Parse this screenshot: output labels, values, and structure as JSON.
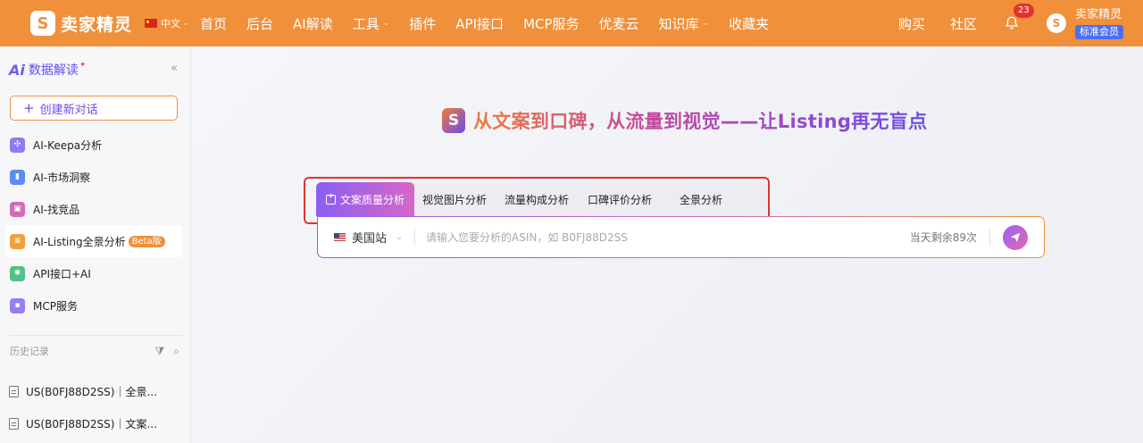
{
  "header": {
    "brand": "卖家精灵",
    "lang": "中文",
    "nav": [
      "首页",
      "后台",
      "AI解读",
      "工具",
      "插件",
      "API接口",
      "MCP服务",
      "优麦云",
      "知识库",
      "收藏夹"
    ],
    "buy": "购买",
    "community": "社区",
    "notification_count": "23",
    "user_name": "卖家精灵",
    "membership": "标准会员",
    "avatar_text": "S"
  },
  "sidebar": {
    "logo": "Ai",
    "title": "数据解读",
    "new_chat": "创建新对话",
    "items": [
      {
        "label": "AI-Keepa分析",
        "color": "#8f7bf2"
      },
      {
        "label": "AI-市场洞察",
        "color": "#5d8cf5"
      },
      {
        "label": "AI-找竞品",
        "color": "#d46bb7"
      },
      {
        "label": "AI-Listing全景分析",
        "color": "#f0a13b",
        "badge": "Beta版"
      },
      {
        "label": "API接口+AI",
        "color": "#52c187"
      },
      {
        "label": "MCP服务",
        "color": "#9a7df3"
      }
    ],
    "history_title": "历史记录",
    "history": [
      "US(B0FJ88D2SS)｜全景...",
      "US(B0FJ88D2SS)｜文案..."
    ]
  },
  "main": {
    "headline": "从文案到口碑，从流量到视觉——让Listing再无盲点",
    "tabs": [
      "文案质量分析",
      "视觉图片分析",
      "流量构成分析",
      "口碑评价分析",
      "全景分析"
    ],
    "active_tab": 0,
    "site": "美国站",
    "search_placeholder": "请输入您要分析的ASIN，如 B0FJ88D2SS",
    "remaining": "当天剩余89次"
  },
  "colors": {
    "header_bg": "#f0903b",
    "accent_purple": "#6a4cf0",
    "highlight_box": "#e0332e"
  }
}
